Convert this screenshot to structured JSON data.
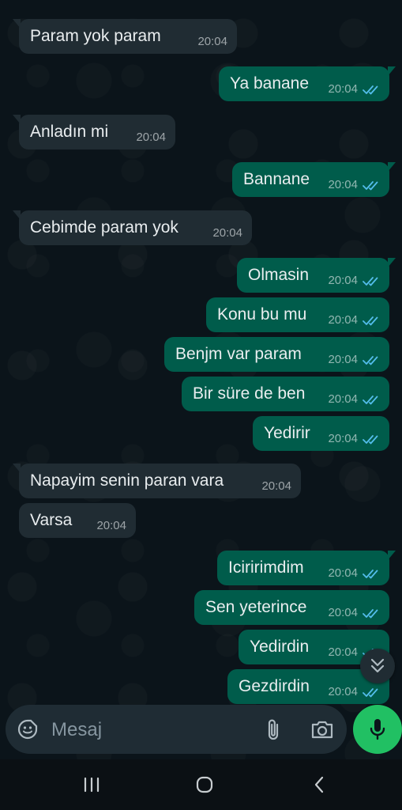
{
  "messages": [
    {
      "dir": "in",
      "text": "Param yok param",
      "time": "20:04"
    },
    {
      "dir": "out",
      "text": "Ya banane",
      "time": "20:04"
    },
    {
      "dir": "in",
      "text": "Anladın mi",
      "time": "20:04"
    },
    {
      "dir": "out",
      "text": "Bannane",
      "time": "20:04"
    },
    {
      "dir": "in",
      "text": "Cebimde param yok",
      "time": "20:04"
    },
    {
      "dir": "out",
      "text": "Olmasin",
      "time": "20:04"
    },
    {
      "dir": "out",
      "text": "Konu bu mu",
      "time": "20:04"
    },
    {
      "dir": "out",
      "text": "Benjm var param",
      "time": "20:04"
    },
    {
      "dir": "out",
      "text": "Bir süre de ben",
      "time": "20:04"
    },
    {
      "dir": "out",
      "text": "Yedirir",
      "time": "20:04"
    },
    {
      "dir": "in",
      "text": "Napayim senin paran vara",
      "time": "20:04"
    },
    {
      "dir": "in",
      "text": "Varsa",
      "time": "20:04"
    },
    {
      "dir": "out",
      "text": "Iciririmdim",
      "time": "20:04"
    },
    {
      "dir": "out",
      "text": "Sen yeterince",
      "time": "20:04"
    },
    {
      "dir": "out",
      "text": "Yedirdin",
      "time": "20:04"
    },
    {
      "dir": "out",
      "text": "Gezdirdin",
      "time": "20:04"
    }
  ],
  "composer": {
    "placeholder": "Mesaj",
    "emoji_icon": "sticker-smiley-icon",
    "attach_icon": "paperclip-icon",
    "camera_icon": "camera-icon",
    "mic_icon": "microphone-icon"
  },
  "scroll_down_icon": "double-chevron-down-icon",
  "navbar": {
    "recents_icon": "recent-apps-icon",
    "home_icon": "home-icon",
    "back_icon": "back-chevron-icon"
  },
  "colors": {
    "chat_background": "#0b141a",
    "incoming_bubble": "#202c33",
    "outgoing_bubble": "#005c4b",
    "read_ticks": "#53bdeb",
    "mic_button": "#21c063"
  }
}
